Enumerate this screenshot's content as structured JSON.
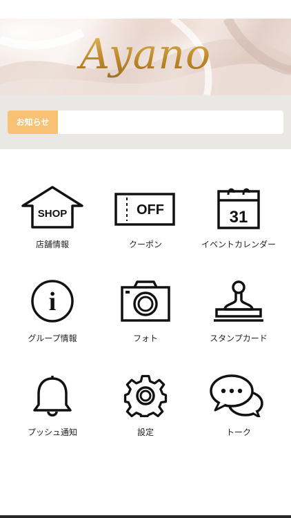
{
  "banner": {
    "logo_text": "Ayano"
  },
  "notice": {
    "label": "お知らせ",
    "text": ""
  },
  "menu": [
    {
      "label": "店舗情報",
      "icon": "shop-icon",
      "icon_text": "SHOP"
    },
    {
      "label": "クーポン",
      "icon": "coupon-icon",
      "icon_text": "OFF"
    },
    {
      "label": "イベントカレンダー",
      "icon": "calendar-icon",
      "icon_text": "31"
    },
    {
      "label": "グループ情報",
      "icon": "info-icon",
      "icon_text": "i"
    },
    {
      "label": "フォト",
      "icon": "camera-icon"
    },
    {
      "label": "スタンプカード",
      "icon": "stamp-icon"
    },
    {
      "label": "プッシュ通知",
      "icon": "bell-icon"
    },
    {
      "label": "設定",
      "icon": "gear-icon"
    },
    {
      "label": "トーク",
      "icon": "chat-icon"
    }
  ],
  "colors": {
    "notice_label_bg": "#f8c173",
    "logo_gold": "#c99a38",
    "icon_stroke": "#111111"
  }
}
